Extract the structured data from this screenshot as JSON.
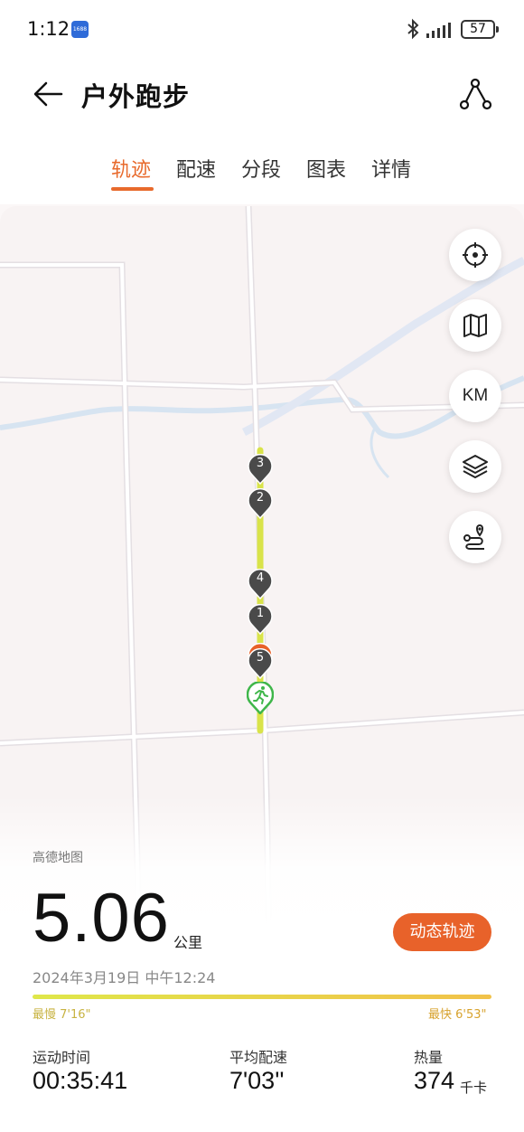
{
  "status_bar": {
    "time": "1:12",
    "app_badge": "1688",
    "battery": "57",
    "icons": [
      "bluetooth-icon",
      "signal-icon",
      "battery-icon"
    ]
  },
  "header": {
    "title": "户外跑步",
    "back_icon": "arrow-left-icon",
    "route_icon": "route-share-icon"
  },
  "tabs": [
    {
      "label": "轨迹",
      "active": true
    },
    {
      "label": "配速",
      "active": false
    },
    {
      "label": "分段",
      "active": false
    },
    {
      "label": "图表",
      "active": false
    },
    {
      "label": "详情",
      "active": false
    }
  ],
  "map": {
    "km_label": "KM",
    "buttons": [
      "locate-icon",
      "map-icon",
      "km-toggle",
      "layers-icon",
      "route-pin-icon"
    ],
    "markers": [
      "3",
      "2",
      "4",
      "1",
      "5"
    ],
    "attribution": "高德地图"
  },
  "summary": {
    "distance": "5.06",
    "distance_unit": "公里",
    "dynamic_track_label": "动态轨迹",
    "datetime": "2024年3月19日 中午12:24",
    "slowest": "最慢 7'16\"",
    "fastest": "最快 6'53\""
  },
  "stats": [
    {
      "label": "运动时间",
      "value": "00:35:41",
      "unit": ""
    },
    {
      "label": "平均配速",
      "value": "7'03''",
      "unit": ""
    },
    {
      "label": "热量",
      "value": "374",
      "unit": "千卡"
    }
  ],
  "colors": {
    "accent": "#e86a2c",
    "track": "#d9e34a",
    "start": "#3fb64a",
    "water": "#d7e4f1"
  }
}
